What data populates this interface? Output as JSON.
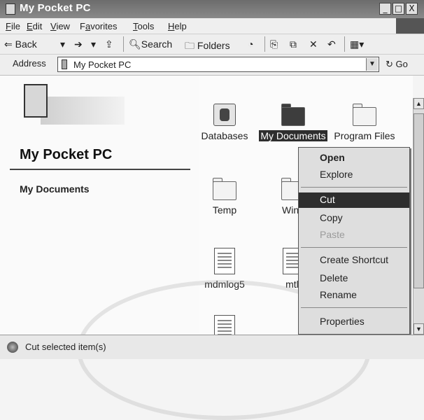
{
  "window": {
    "title": "My Pocket PC",
    "min": "_",
    "max": "□",
    "close": "X"
  },
  "menubar": [
    {
      "u": "F",
      "rest": "ile"
    },
    {
      "u": "E",
      "rest": "dit"
    },
    {
      "u": "V",
      "rest": "iew"
    },
    {
      "pre": "F",
      "u": "a",
      "rest": "vorites"
    },
    {
      "u": "T",
      "rest": "ools"
    },
    {
      "u": "H",
      "rest": "elp"
    }
  ],
  "toolbar": {
    "back": "⇐ Back",
    "back_drop": "▾",
    "forward": "➔",
    "fwd_drop": "▾",
    "up_icon": "⇪",
    "search": "Search",
    "folders": "Folders",
    "history_icon": "◔",
    "move_to": "⎘",
    "copy_to": "⧉",
    "delete": "✕",
    "undo": "↶",
    "views": "▦▾"
  },
  "address": {
    "label": "Address",
    "value": "My Pocket PC",
    "go": "Go"
  },
  "left_pane": {
    "folder_title": "My Pocket PC",
    "link": "My Documents"
  },
  "items": [
    {
      "label": "Databases",
      "icon": "database-icon"
    },
    {
      "label": "My Documents",
      "icon": "folder-icon",
      "selected": true
    },
    {
      "label": "Program Files",
      "icon": "folder-icon"
    },
    {
      "label": "Temp",
      "icon": "folder-icon"
    },
    {
      "label": "Wind",
      "icon": "folder-icon"
    },
    {
      "label": "mdmlog5",
      "icon": "document-icon"
    },
    {
      "label": "mtli",
      "icon": "document-icon"
    }
  ],
  "context_menu": {
    "open": "Open",
    "explore": "Explore",
    "cut": "Cut",
    "copy": "Copy",
    "paste": "Paste",
    "create_shortcut": "Create Shortcut",
    "delete": "Delete",
    "rename": "Rename",
    "properties": "Properties"
  },
  "status": {
    "text": "Cut selected item(s)"
  },
  "colors": {
    "highlight": "#2e2e2e",
    "titlebar": "#7a7a7a"
  }
}
